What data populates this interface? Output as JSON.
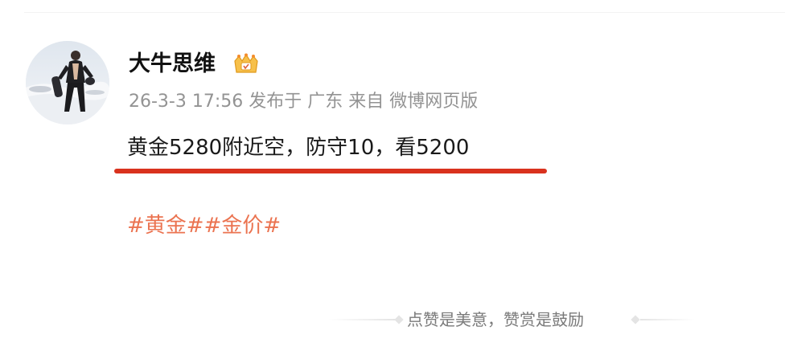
{
  "post": {
    "author": {
      "name": "大牛思维",
      "badge_icon": "vip-crown-icon"
    },
    "meta": "26-3-3 17:56 发布于 广东 来自 微博网页版",
    "text": "黄金5280附近空，防守10，看5200",
    "highlight_color": "#d9321e",
    "tags": [
      "#黄金#",
      "#金价#"
    ],
    "tag_color": "#eb7350"
  },
  "footer": {
    "encourage_text": "点赞是美意，赞赏是鼓励"
  }
}
